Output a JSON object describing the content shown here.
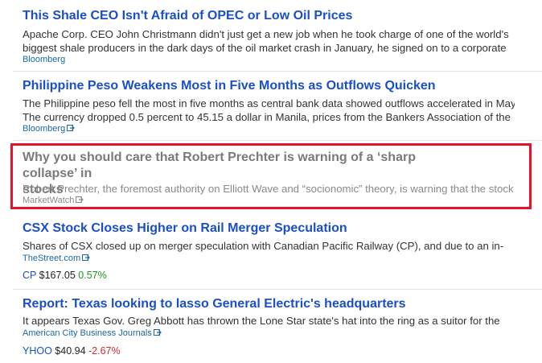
{
  "feed": {
    "items": [
      {
        "title": "This Shale CEO Isn't Afraid of OPEC or Low Oil Prices",
        "snippet": [
          "Apache Corp. CEO John Christmann didn't just get a new job when he took charge of one of the world's",
          "biggest shale producers in the dark days of the oil market crash in January, he signed on to a corporate"
        ],
        "source": "Bloomberg"
      },
      {
        "title": "Philippine Peso Weakens Most in Five Months as Outflows Quicken",
        "snippet": [
          "The Philippine peso fell the most in five months as central bank data showed outflows accelerated in May.",
          "The currency dropped 0.5 percent to 45.15 a dollar in Manila, prices from the Bankers Association of the"
        ],
        "source": "Bloomberg"
      },
      {
        "title": "Why you should care that Robert Prechter is warning of a ‘sharp collapse’ in stocks",
        "title_lines": [
          "Why you should care that Robert Prechter is warning of a ‘sharp collapse’ in",
          "stocks"
        ],
        "snippet": [
          "Robert Prechter, the foremost authority on Elliott Wave and “socionomic” theory, is warning that the stock"
        ],
        "source": "MarketWatch"
      },
      {
        "title": "CSX Stock Closes Higher on Rail Merger Speculation",
        "snippet": [
          "Shares of CSX closed up on merger speculation with Canadian Pacific Railway (CP), and due to an in-"
        ],
        "source": "TheStreet.com",
        "quote": {
          "ticker": "CP",
          "price": "$167.05",
          "change": "0.57%",
          "direction": "up"
        }
      },
      {
        "title": "Report: Texas looking to lasso General Electric's headquarters",
        "snippet": [
          "It appears Texas Gov. Greg Abbott has thrown the Lone Star state's hat into the ring as a suitor for the"
        ],
        "source": "American City Business Journals",
        "quote": {
          "ticker": "YHOO",
          "price": "$40.94",
          "change": "-2.67%",
          "direction": "down"
        }
      }
    ]
  },
  "colors": {
    "link": "#1a4fc9",
    "visited": "#7a7a7a",
    "highlight_border": "#e8132a",
    "up": "#1c9a1c",
    "down": "#d42a2a"
  },
  "icons": {
    "external": "external-link-icon"
  }
}
